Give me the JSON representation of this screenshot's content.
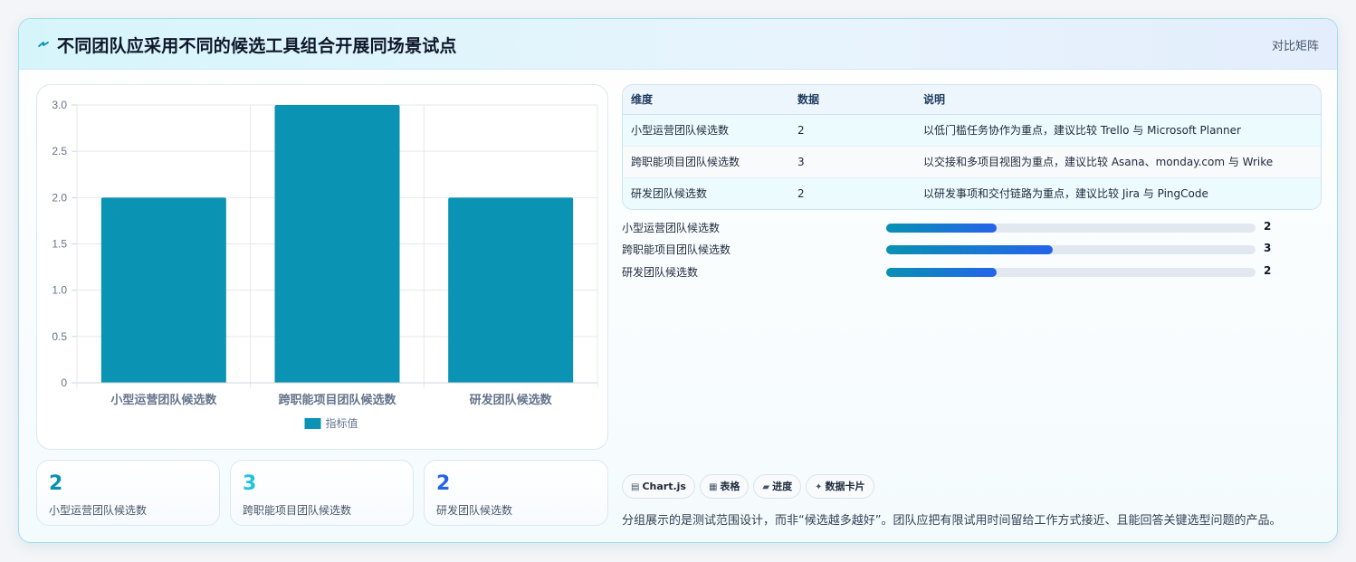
{
  "header": {
    "title": "不同团队应采用不同的候选工具组合开展同场景试点",
    "badge": "对比矩阵",
    "icon": "bolt-icon"
  },
  "colors": {
    "bar": "#0a93b3",
    "accent_teal": "#0891b2",
    "accent_cyan": "#22c3dd",
    "accent_blue": "#2563eb"
  },
  "chart_data": {
    "type": "bar",
    "categories": [
      "小型运营团队候选数",
      "跨职能项目团队候选数",
      "研发团队候选数"
    ],
    "series": [
      {
        "name": "指标值",
        "values": [
          2,
          3,
          2
        ]
      }
    ],
    "ylim": [
      0,
      3
    ],
    "yticks": [
      "0",
      "0.5",
      "1.0",
      "1.5",
      "2.0",
      "2.5",
      "3.0"
    ],
    "grid": true,
    "legend": "bottom"
  },
  "stats": [
    {
      "value": "2",
      "label": "小型运营团队候选数",
      "color": "#0891b2"
    },
    {
      "value": "3",
      "label": "跨职能项目团队候选数",
      "color": "#22c3dd"
    },
    {
      "value": "2",
      "label": "研发团队候选数",
      "color": "#2563eb"
    }
  ],
  "table": {
    "headers": [
      "维度",
      "数据",
      "说明"
    ],
    "rows": [
      [
        "小型运营团队候选数",
        "2",
        "以低门槛任务协作为重点，建议比较 Trello 与 Microsoft Planner"
      ],
      [
        "跨职能项目团队候选数",
        "3",
        "以交接和多项目视图为重点，建议比较 Asana、monday.com 与 Wrike"
      ],
      [
        "研发团队候选数",
        "2",
        "以研发事项和交付链路为重点，建议比较 Jira 与 PingCode"
      ]
    ]
  },
  "progress": [
    {
      "label": "小型运营团队候选数",
      "value": "2",
      "fraction": 0.3
    },
    {
      "label": "跨职能项目团队候选数",
      "value": "3",
      "fraction": 0.45
    },
    {
      "label": "研发团队候选数",
      "value": "2",
      "fraction": 0.3
    }
  ],
  "chips": [
    {
      "icon": "chart-icon",
      "glyph": "▤",
      "label": "Chart.js"
    },
    {
      "icon": "table-icon",
      "glyph": "▦",
      "label": "表格"
    },
    {
      "icon": "progress-icon",
      "glyph": "▰",
      "label": "进度"
    },
    {
      "icon": "card-icon",
      "glyph": "✦",
      "label": "数据卡片"
    }
  ],
  "note": "分组展示的是测试范围设计，而非“候选越多越好”。团队应把有限试用时间留给工作方式接近、且能回答关键选型问题的产品。"
}
